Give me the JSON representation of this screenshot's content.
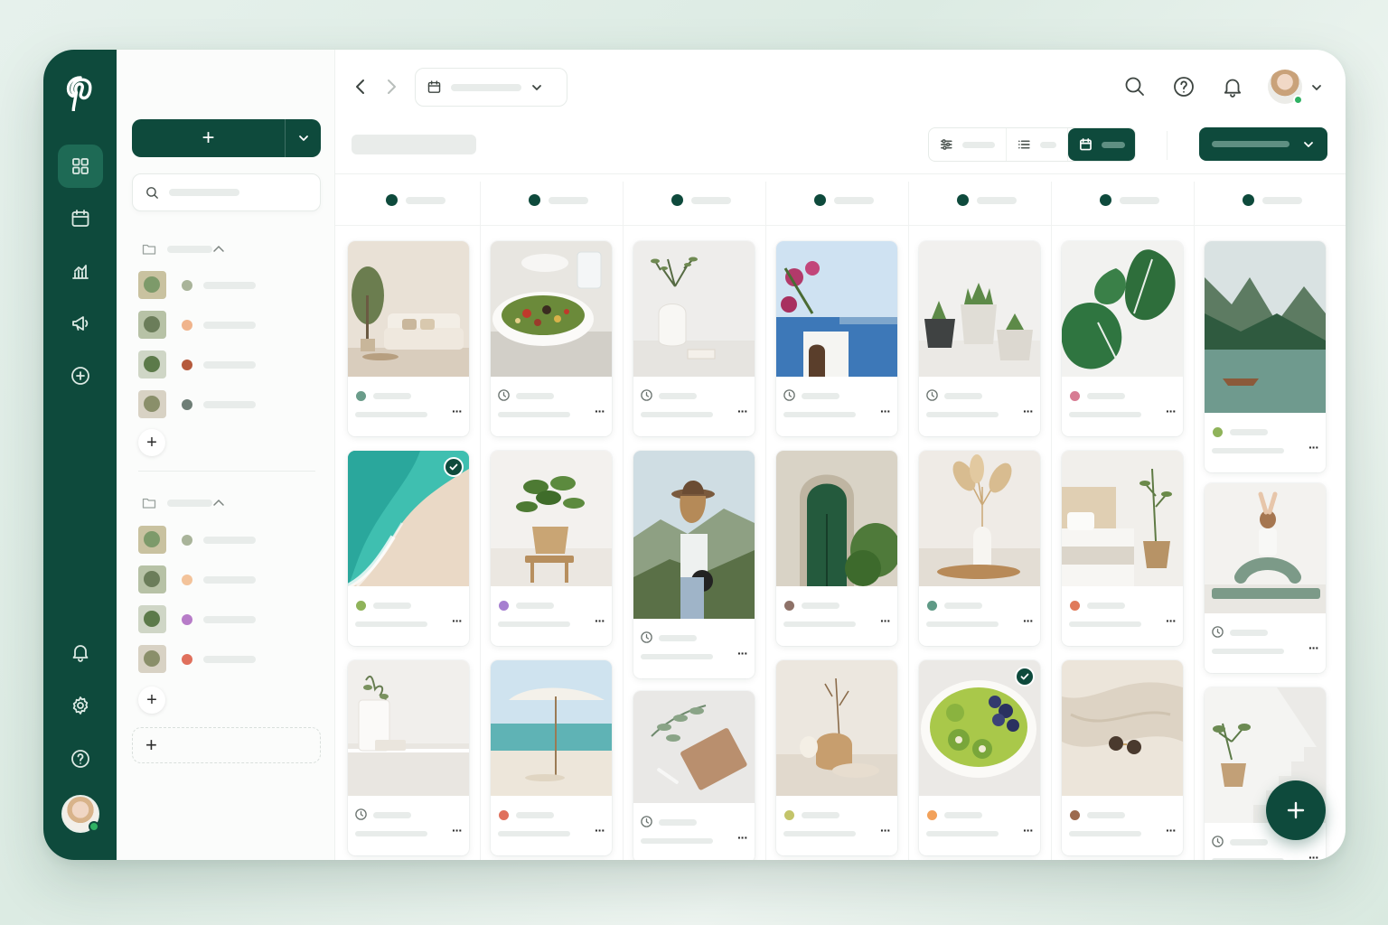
{
  "app": {
    "brand_icon": "pinterest-logo",
    "accent": "#0e4a3c",
    "accent_light": "#1e6a55"
  },
  "rail": {
    "items": [
      {
        "icon": "grid-icon",
        "active": true
      },
      {
        "icon": "calendar-icon",
        "active": false
      },
      {
        "icon": "analytics-icon",
        "active": false
      },
      {
        "icon": "megaphone-icon",
        "active": false
      },
      {
        "icon": "plus-circle-icon",
        "active": false
      }
    ],
    "bottom": [
      "bell-icon",
      "gear-icon",
      "help-icon"
    ],
    "status": "online"
  },
  "panel": {
    "create_label": "+",
    "groups": [
      {
        "icon": "folder-icon",
        "expanded": true,
        "boards": [
          {
            "color": "#a9b49a"
          },
          {
            "color": "#f0b48c"
          },
          {
            "color": "#b55a3c"
          },
          {
            "color": "#6e7e76"
          }
        ]
      },
      {
        "icon": "folder-icon",
        "expanded": true,
        "boards": [
          {
            "color": "#a9b49a"
          },
          {
            "color": "#f3c39a"
          },
          {
            "color": "#b77cc8"
          },
          {
            "color": "#e0705c"
          }
        ]
      }
    ],
    "add_label": "+"
  },
  "columns": 7,
  "pins": [
    [
      {
        "status_color": "#6a9c8a",
        "scheduled": false,
        "checked": false,
        "scene": "living-room"
      },
      {
        "status_color": "#8fb35a",
        "scheduled": false,
        "checked": true,
        "scene": "beach-aerial"
      },
      {
        "status_color": "",
        "scheduled": true,
        "checked": false,
        "scene": "vase-shelf"
      }
    ],
    [
      {
        "status_color": "",
        "scheduled": true,
        "checked": false,
        "scene": "salad-bowl"
      },
      {
        "status_color": "#a67fd0",
        "scheduled": false,
        "checked": false,
        "scene": "potted-plant"
      },
      {
        "status_color": "#e0705c",
        "scheduled": false,
        "checked": false,
        "scene": "beach-umbrella"
      }
    ],
    [
      {
        "status_color": "",
        "scheduled": true,
        "checked": false,
        "scene": "branch-vase"
      },
      {
        "status_color": "",
        "scheduled": true,
        "checked": false,
        "scene": "hiker-hat"
      },
      {
        "status_color": "",
        "scheduled": true,
        "checked": false,
        "scene": "notebook-leaves"
      }
    ],
    [
      {
        "status_color": "",
        "scheduled": true,
        "checked": false,
        "scene": "santorini"
      },
      {
        "status_color": "#8e7268",
        "scheduled": false,
        "checked": false,
        "scene": "green-door"
      },
      {
        "status_color": "#c3c46a",
        "scheduled": false,
        "checked": false,
        "scene": "ceramic-still"
      }
    ],
    [
      {
        "status_color": "",
        "scheduled": true,
        "checked": false,
        "scene": "succulents"
      },
      {
        "status_color": "#5f9a86",
        "scheduled": false,
        "checked": false,
        "scene": "pampas-vase"
      },
      {
        "status_color": "#f2a15a",
        "scheduled": false,
        "checked": true,
        "scene": "kiwi-bowl"
      }
    ],
    [
      {
        "status_color": "#d77c93",
        "scheduled": false,
        "checked": false,
        "scene": "monstera"
      },
      {
        "status_color": "#e07a5a",
        "scheduled": false,
        "checked": false,
        "scene": "bedroom"
      },
      {
        "status_color": "#9c6a4e",
        "scheduled": false,
        "checked": false,
        "scene": "linen-sunglasses"
      }
    ],
    [
      {
        "status_color": "#8fb35a",
        "scheduled": false,
        "checked": false,
        "scene": "lake-boat"
      },
      {
        "status_color": "",
        "scheduled": true,
        "checked": false,
        "scene": "yoga"
      },
      {
        "status_color": "",
        "scheduled": true,
        "checked": false,
        "scene": "white-stairs"
      }
    ]
  ],
  "fab_label": "+"
}
